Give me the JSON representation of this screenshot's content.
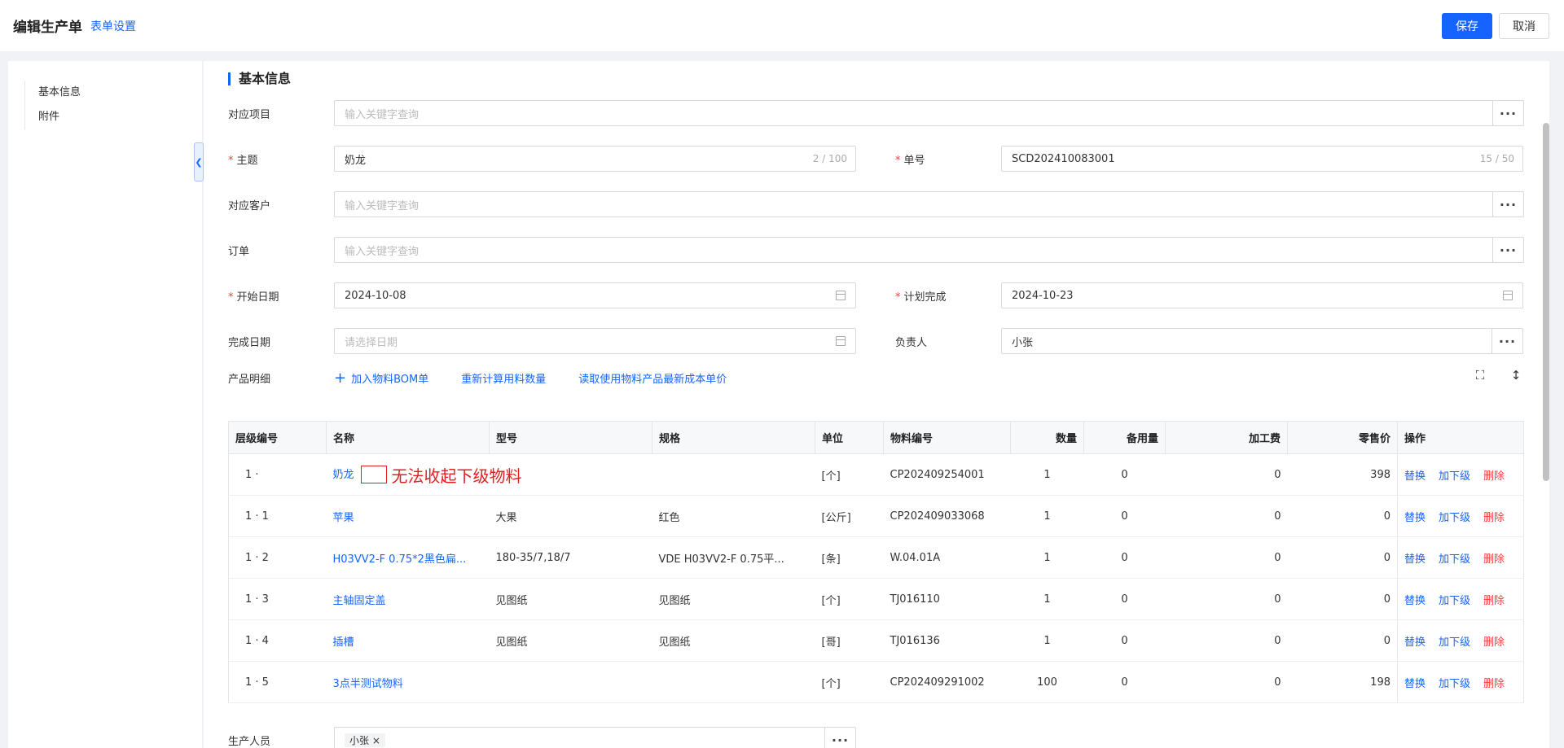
{
  "header": {
    "title": "编辑生产单",
    "form_settings": "表单设置",
    "save_label": "保存",
    "cancel_label": "取消"
  },
  "sidebar": {
    "items": [
      {
        "label": "基本信息"
      },
      {
        "label": "附件"
      }
    ]
  },
  "form": {
    "section_title": "基本信息",
    "project": {
      "label": "对应项目",
      "placeholder": "输入关键字查询"
    },
    "subject": {
      "label": "主题",
      "value": "奶龙",
      "counter": "2 / 100"
    },
    "order_no": {
      "label": "单号",
      "value": "SCD202410083001",
      "counter": "15 / 50"
    },
    "customer": {
      "label": "对应客户",
      "placeholder": "输入关键字查询"
    },
    "order": {
      "label": "订单",
      "placeholder": "输入关键字查询"
    },
    "start_date": {
      "label": "开始日期",
      "value": "2024-10-08"
    },
    "planned_finish": {
      "label": "计划完成",
      "value": "2024-10-23"
    },
    "finish_date": {
      "label": "完成日期",
      "placeholder": "请选择日期"
    },
    "owner": {
      "label": "负责人",
      "value": "小张"
    },
    "product_detail_label": "产品明细",
    "add_bom": "加入物料BOM单",
    "recalc": "重新计算用料数量",
    "read_cost": "读取使用物料产品最新成本单价",
    "bottom_label": "生产人员",
    "bottom_tag": "小张 ×"
  },
  "table": {
    "columns": [
      "层级编号",
      "名称",
      "型号",
      "规格",
      "单位",
      "物料编号",
      "数量",
      "备用量",
      "加工费",
      "零售价",
      "操作"
    ],
    "ops": {
      "replace": "替换",
      "add_child": "加下级",
      "delete": "删除"
    },
    "annotation": "无法收起下级物料",
    "rows": [
      {
        "level": "1 ·",
        "name": "奶龙",
        "model": "",
        "spec": "",
        "unit": "[个]",
        "code": "CP202409254001",
        "qty": "1",
        "spare": "0",
        "fee": "0",
        "price": "398"
      },
      {
        "level": "1 · 1",
        "name": "苹果",
        "model": "大果",
        "spec": "红色",
        "unit": "[公斤]",
        "code": "CP202409033068",
        "qty": "1",
        "spare": "0",
        "fee": "0",
        "price": "0"
      },
      {
        "level": "1 · 2",
        "name": "H03VV2-F 0.75*2黑色扁...",
        "model": "180-35/7,18/7",
        "spec": "VDE H03VV2-F 0.75平...",
        "unit": "[条]",
        "code": "W.04.01A",
        "qty": "1",
        "spare": "0",
        "fee": "0",
        "price": "0"
      },
      {
        "level": "1 · 3",
        "name": "主轴固定盖",
        "model": "见图纸",
        "spec": "见图纸",
        "unit": "[个]",
        "code": "TJ016110",
        "qty": "1",
        "spare": "0",
        "fee": "0",
        "price": "0"
      },
      {
        "level": "1 · 4",
        "name": "插槽",
        "model": "见图纸",
        "spec": "见图纸",
        "unit": "[哥]",
        "code": "TJ016136",
        "qty": "1",
        "spare": "0",
        "fee": "0",
        "price": "0"
      },
      {
        "level": "1 · 5",
        "name": "3点半测试物料",
        "model": "",
        "spec": "",
        "unit": "[个]",
        "code": "CP202409291002",
        "qty": "100",
        "spare": "0",
        "fee": "0",
        "price": "198"
      }
    ]
  }
}
